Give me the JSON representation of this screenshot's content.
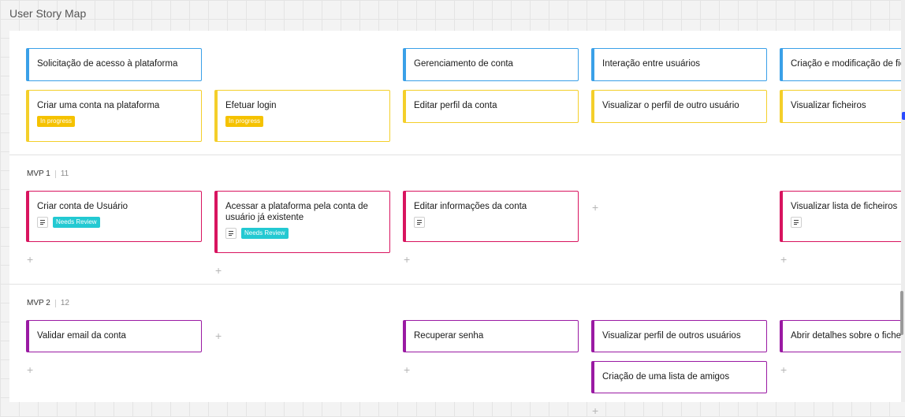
{
  "title": "User Story Map",
  "activities": [
    "Solicitação de acesso à plataforma",
    "Gerenciamento de conta",
    "Interação entre usuários",
    "Criação e modificação de ficheiros"
  ],
  "backbone": [
    {
      "label": "Criar uma conta na plataforma",
      "status": "In progress"
    },
    {
      "label": "Efetuar login",
      "status": "In progress"
    },
    {
      "label": "Editar perfil da conta"
    },
    {
      "label": "Visualizar o perfil de outro usuário"
    },
    {
      "label": "Visualizar ficheiros"
    }
  ],
  "releases": [
    {
      "name": "MVP 1",
      "count": "11",
      "cards": [
        {
          "label": "Criar conta de Usuário",
          "status": "Needs Review"
        },
        {
          "label": "Acessar a plataforma pela conta de usuário já existente",
          "status": "Needs Review"
        },
        {
          "label": "Editar informações da conta"
        },
        {
          "label": "Visualizar lista de ficheiros"
        }
      ]
    },
    {
      "name": "MVP 2",
      "count": "12",
      "cards": [
        {
          "label": "Validar email da conta"
        },
        {
          "label": "Recuperar senha"
        },
        {
          "label": "Visualizar perfil de outros usuários"
        },
        {
          "label": "Criação de uma lista de amigos"
        },
        {
          "label": "Abrir detalhes sobre o ficheiro"
        }
      ]
    }
  ],
  "add_symbol": "+",
  "colors": {
    "activity": "#3aa0e8",
    "backbone": "#f4cf2a",
    "mvp1": "#d8145f",
    "mvp2": "#9a1aa3",
    "in_progress_badge": "#f5c200",
    "needs_review_badge": "#23c9d2"
  }
}
